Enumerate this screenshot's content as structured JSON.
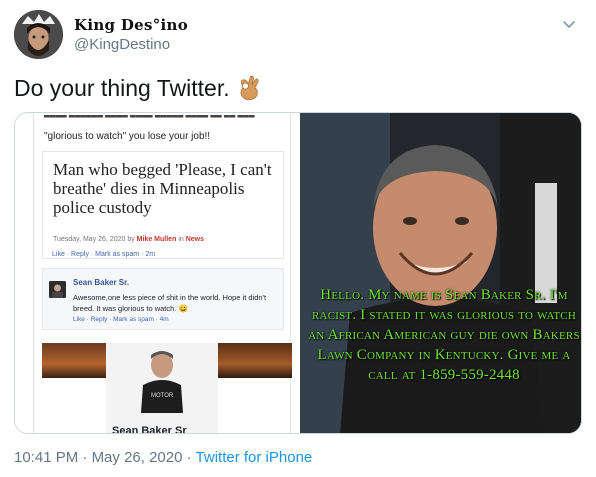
{
  "tweet": {
    "display_name": "𝖎𝖎𝖓𝖌 Des𝖙ino",
    "display_name_plain": "King Des°ino",
    "handle": "@KingDestino",
    "text": "Do your thing Twitter.",
    "emoji": "ok-hand",
    "time": "10:41 PM",
    "separator": "·",
    "date": "May 26, 2020",
    "source": "Twitter for iPhone"
  },
  "media_left": {
    "quote_line": "\"glorious to watch\" you lose your job!!",
    "headline": "Man who begged 'Please, I can't breathe' dies in Minneapolis police custody",
    "dateline_prefix": "Tuesday, May 26, 2020 by",
    "dateline_author": "Mike Mullen",
    "dateline_in": "in",
    "dateline_section": "News",
    "actions_1": "Like · Reply · Mark as spam · 2m",
    "commenter": "Sean Baker Sr.",
    "comment_body": "Awesome,one less piece of shit in the world. Hope it didn't breed. It was glorious to watch. 😀",
    "actions_2": "Like · Reply · Mark as spam · 4m",
    "profile_name": "Sean Baker Sr"
  },
  "media_right": {
    "overlay_text": "Hello. My name is Sean Baker Sr. I'm racist. I stated it was glorious to watch an African American guy die own Bakers Lawn Company in Kentucky. Give me a call at 1-859-559-2448"
  },
  "colors": {
    "link": "#1b95e0",
    "secondary": "#657786",
    "overlay_green": "#6fe32b"
  }
}
